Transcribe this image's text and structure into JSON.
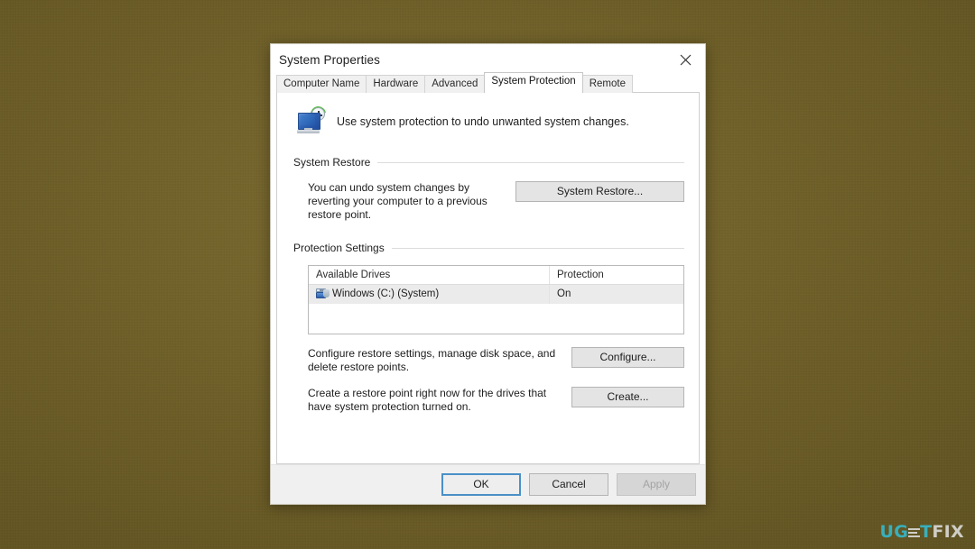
{
  "desktop": {
    "background_color": "#6b5c25",
    "watermark": {
      "part1": "UG",
      "part2": "T",
      "part3": "FIX",
      "accent_color": "#35b7c9",
      "light_color": "#d8d8d4"
    }
  },
  "dialog": {
    "title": "System Properties",
    "close_label": "Close",
    "tabs": [
      {
        "label": "Computer Name",
        "active": false
      },
      {
        "label": "Hardware",
        "active": false
      },
      {
        "label": "Advanced",
        "active": false
      },
      {
        "label": "System Protection",
        "active": true
      },
      {
        "label": "Remote",
        "active": false
      }
    ],
    "header": {
      "icon": "system-protection-icon",
      "text": "Use system protection to undo unwanted system changes."
    },
    "system_restore": {
      "group_title": "System Restore",
      "description": "You can undo system changes by reverting your computer to a previous restore point.",
      "button_label": "System Restore..."
    },
    "protection_settings": {
      "group_title": "Protection Settings",
      "columns": [
        "Available Drives",
        "Protection"
      ],
      "rows": [
        {
          "drive": "Windows (C:) (System)",
          "protection": "On",
          "selected": true
        }
      ],
      "configure": {
        "description": "Configure restore settings, manage disk space, and delete restore points.",
        "button_label": "Configure..."
      },
      "create": {
        "description": "Create a restore point right now for the drives that have system protection turned on.",
        "button_label": "Create..."
      }
    },
    "command_bar": {
      "ok": "OK",
      "cancel": "Cancel",
      "apply": "Apply",
      "apply_disabled": true,
      "ok_focused": true
    }
  }
}
